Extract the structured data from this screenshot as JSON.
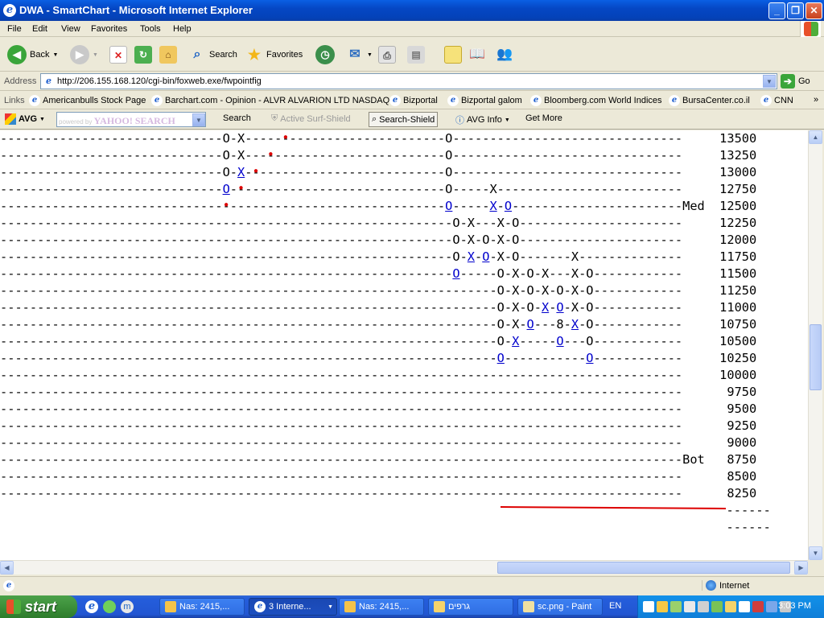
{
  "window": {
    "title": "DWA - SmartChart - Microsoft Internet Explorer",
    "buttons": [
      "_",
      "❐",
      "✕"
    ]
  },
  "menu": [
    "File",
    "Edit",
    "View",
    "Favorites",
    "Tools",
    "Help"
  ],
  "toolbar": {
    "back": "Back",
    "search": "Search",
    "favorites": "Favorites"
  },
  "address": {
    "label": "Address",
    "url": "http://206.155.168.120/cgi-bin/foxweb.exe/fwpointfig",
    "go": "Go"
  },
  "links": {
    "label": "Links",
    "items": [
      "Americanbulls Stock Page",
      "Barchart.com - Opinion - ALVR ALVARION LTD NASDAQ",
      "Bizportal",
      "Bizportal galom",
      "Bloomberg.com World Indices",
      "BursaCenter.co.il",
      "CNN"
    ],
    "more": "»"
  },
  "avgbar": {
    "brand": "AVG",
    "yahoo_hint": "powered by",
    "yahoo_logo": "YAHOO! SEARCH",
    "search": "Search",
    "active_surf": "Active  Surf-Shield",
    "search_shield": "Search-Shield",
    "avg_info": "AVG Info",
    "get_more": "Get More"
  },
  "chart": {
    "rows": [
      {
        "price": "13500",
        "text": "------------------------------O-X-----•---------------------O------------------------------"
      },
      {
        "price": "13250",
        "text": "------------------------------O-X---•-----------------------O------------------------------"
      },
      {
        "price": "13000",
        "text": "------------------------------O-X-•-------------------------O------------------------------"
      },
      {
        "price": "12750",
        "text": "------------------------------O-•---------------------------O-----X------------------------"
      },
      {
        "price": "12500",
        "text": "------------------------------•-----------------------------O-----X-O----------------------",
        "tag": "Med"
      },
      {
        "price": "12250",
        "text": "-------------------------------------------------------------O-X---X-O----------------------"
      },
      {
        "price": "12000",
        "text": "-------------------------------------------------------------O-X-O-X-O----------------------"
      },
      {
        "price": "11750",
        "text": "-------------------------------------------------------------O-X-O-X-O-------X--------------"
      },
      {
        "price": "11500",
        "text": "-------------------------------------------------------------O-----O-X-O-X---X-O------------"
      },
      {
        "price": "11250",
        "text": "-------------------------------------------------------------------O-X-O-X-O-X-O------------"
      },
      {
        "price": "11000",
        "text": "-------------------------------------------------------------------O-X-O-X-O-X-O------------"
      },
      {
        "price": "10750",
        "text": "-------------------------------------------------------------------O-X-O---8-X-O------------"
      },
      {
        "price": "10500",
        "text": "-------------------------------------------------------------------O-X-----O---O------------"
      },
      {
        "price": "10250",
        "text": "-------------------------------------------------------------------O-----------O------------"
      },
      {
        "price": "10000",
        "text": "---------------------------------------------------------------------------------------------"
      },
      {
        "price": "9750",
        "text": "---------------------------------------------------------------------------------------------"
      },
      {
        "price": "9500",
        "text": "---------------------------------------------------------------------------------------------"
      },
      {
        "price": "9250",
        "text": "---------------------------------------------------------------------------------------------"
      },
      {
        "price": "9000",
        "text": "---------------------------------------------------------------------------------------------"
      },
      {
        "price": "8750",
        "text": "---------------------------------------------------------------------------------------------",
        "tag": "Bot"
      },
      {
        "price": "8500",
        "text": "---------------------------------------------------------------------------------------------"
      },
      {
        "price": "8250",
        "text": "---------------------------------------------------------------------------------------------"
      }
    ],
    "tail_lines": [
      "------",
      "------"
    ],
    "annotation_color": "#dd0000"
  },
  "status": {
    "zone": "Internet"
  },
  "taskbar": {
    "start": "start",
    "buttons": [
      "Nas: 2415,...",
      "3 Interne...",
      "Nas: 2415,...",
      "גרפים",
      "sc.png - Paint"
    ],
    "lang": "EN",
    "clock": "3:03 PM"
  }
}
